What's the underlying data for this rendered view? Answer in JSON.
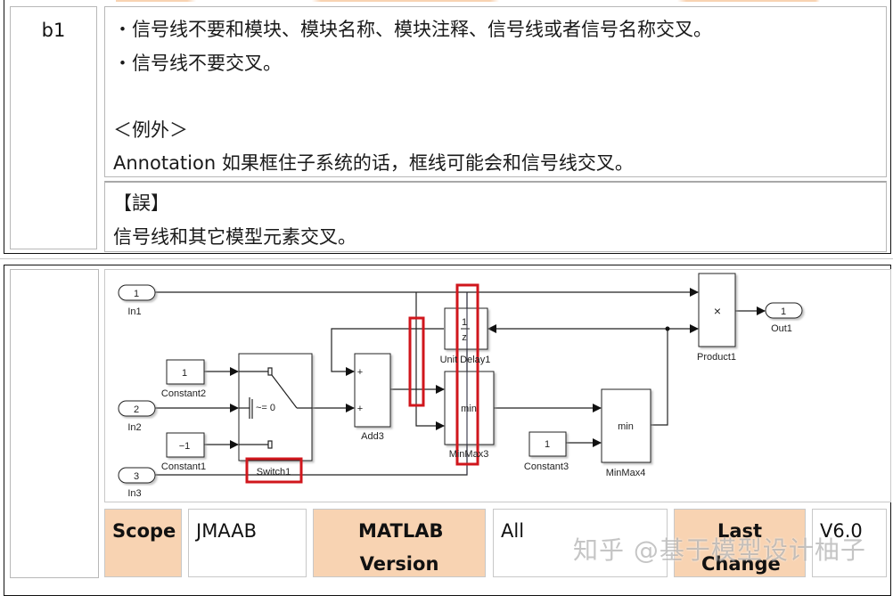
{
  "rule": {
    "id": "b1",
    "description": [
      "・信号线不要和模块、模块名称、模块注释、信号线或者信号名称交叉。",
      "・信号线不要交叉。",
      "",
      "＜例外＞",
      "Annotation 如果框住子系统的话，框线可能会和信号线交叉。"
    ],
    "incorrect_title": "【誤】",
    "incorrect_text": "信号线和其它模型元素交叉。"
  },
  "diagram": {
    "blocks": {
      "in1": {
        "value": "1",
        "label": "In1"
      },
      "in2": {
        "value": "2",
        "label": "In2"
      },
      "in3": {
        "value": "3",
        "label": "In3"
      },
      "constant2": {
        "value": "1",
        "label": "Constant2"
      },
      "constant1": {
        "value": "−1",
        "label": "Constant1"
      },
      "constant3": {
        "value": "1",
        "label": "Constant3"
      },
      "switch1": {
        "label": "Switch1",
        "criteria": "~= 0"
      },
      "add3": {
        "label": "Add3",
        "sign1": "+",
        "sign2": "+"
      },
      "unit_delay1": {
        "num": "1",
        "den": "z",
        "label": "Unit Delay1"
      },
      "minmax3": {
        "op": "min",
        "label": "MinMax3"
      },
      "minmax4": {
        "op": "min",
        "label": "MinMax4"
      },
      "product1": {
        "op": "×",
        "label": "Product1"
      },
      "out1": {
        "value": "1",
        "label": "Out1"
      }
    },
    "highlight_color": "#d0161c"
  },
  "meta": {
    "scope_label": "Scope",
    "scope_value": "JMAAB",
    "matlab_version_label": "MATLAB Version",
    "matlab_version_value": "All",
    "last_change_label": "Last Change",
    "last_change_value": "V6.0"
  },
  "colors": {
    "header_fill": "#f8d3b2",
    "border": "#b8b8b8"
  },
  "watermark": "知乎 @基于模型设计柚子"
}
